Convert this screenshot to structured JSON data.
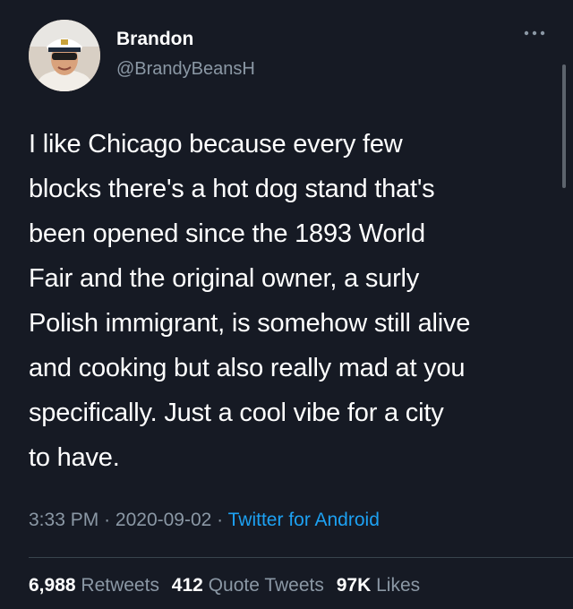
{
  "author": {
    "name": "Brandon",
    "handle": "@BrandyBeansH"
  },
  "menu_icon": "more-horizontal-icon",
  "tweet_text": "I like Chicago because every few\nblocks there's a hot dog stand that's\nbeen opened since the 1893 World\nFair and the original owner, a surly\nPolish immigrant, is somehow still alive\nand cooking but also really mad at you\nspecifically. Just a cool vibe for a city\nto have.",
  "meta": {
    "time": "3:33 PM",
    "separator": "·",
    "date": "2020-09-02",
    "source": "Twitter for Android"
  },
  "stats": {
    "retweets_count": "6,988",
    "retweets_label": "Retweets",
    "quote_count": "412",
    "quote_label": "Quote Tweets",
    "likes_count": "97K",
    "likes_label": "Likes"
  },
  "colors": {
    "background": "#161a24",
    "text": "#ffffff",
    "secondary": "#8b98a5",
    "link": "#1da1f2"
  }
}
